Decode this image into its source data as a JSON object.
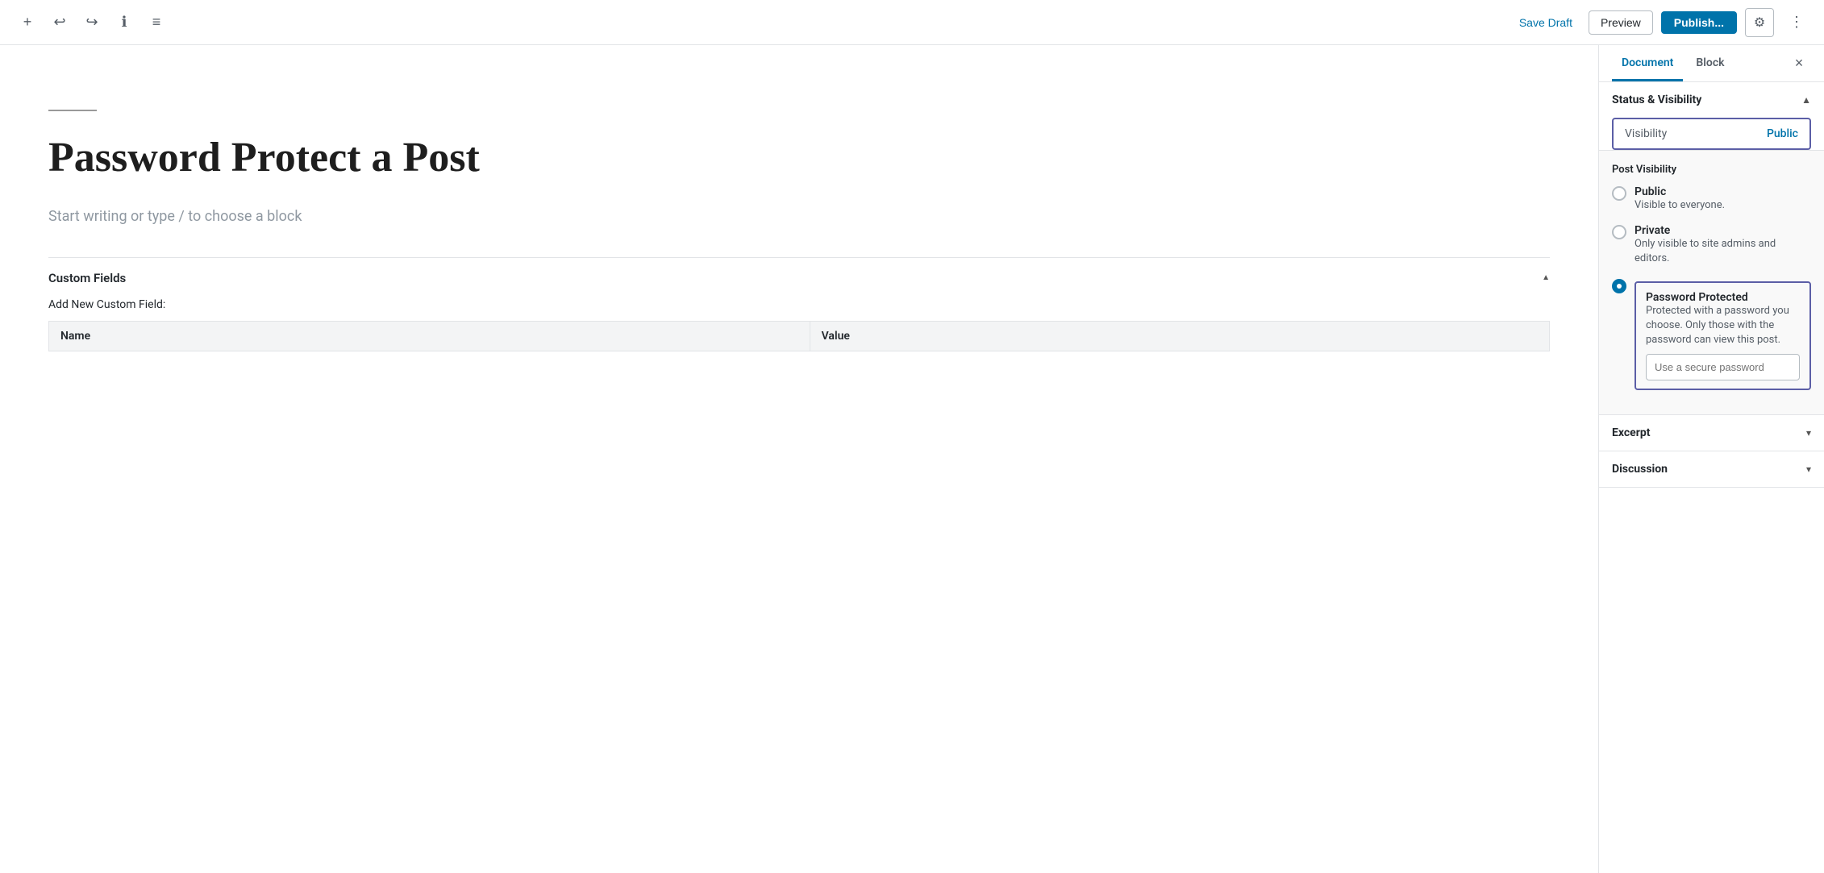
{
  "toolbar": {
    "save_draft_label": "Save Draft",
    "preview_label": "Preview",
    "publish_label": "Publish...",
    "more_options_tooltip": "More options"
  },
  "editor": {
    "title": "Password Protect a Post",
    "placeholder": "Start writing or type / to choose a block"
  },
  "custom_fields": {
    "section_title": "Custom Fields",
    "add_new_label": "Add New Custom Field:",
    "table_headers": [
      "Name",
      "Value"
    ]
  },
  "sidebar": {
    "tabs": [
      {
        "label": "Document",
        "active": true
      },
      {
        "label": "Block",
        "active": false
      }
    ],
    "close_label": "×",
    "status_visibility": {
      "title": "Status & Visibility",
      "visibility_label": "Visibility",
      "visibility_value": "Public",
      "post_visibility_title": "Post Visibility",
      "options": [
        {
          "name": "Public",
          "desc": "Visible to everyone.",
          "selected": false
        },
        {
          "name": "Private",
          "desc": "Only visible to site admins and editors.",
          "selected": false
        },
        {
          "name": "Password Protected",
          "desc": "Protected with a password you choose. Only those with the password can view this post.",
          "selected": true
        }
      ],
      "password_placeholder": "Use a secure password"
    },
    "excerpt": {
      "title": "Excerpt"
    },
    "discussion": {
      "title": "Discussion"
    }
  },
  "icons": {
    "plus": "+",
    "undo": "↩",
    "redo": "↪",
    "info": "ℹ",
    "menu": "≡",
    "settings": "⚙",
    "more": "⋮",
    "close": "×",
    "chevron_up": "▲",
    "chevron_down": "▾",
    "triangle_up": "▲"
  }
}
